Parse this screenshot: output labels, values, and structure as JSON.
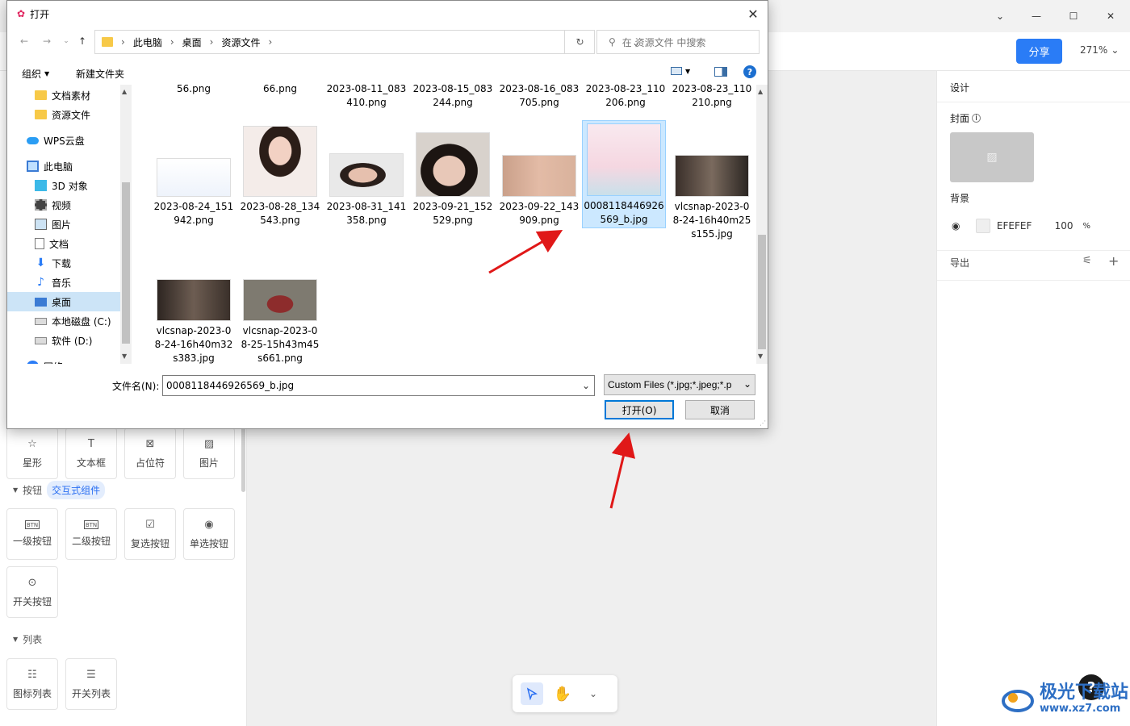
{
  "dialog": {
    "title": "打开",
    "breadcrumb": [
      "此电脑",
      "桌面",
      "资源文件"
    ],
    "search_placeholder": "在 资源文件 中搜索",
    "toolbar": {
      "organize": "组织",
      "new_folder": "新建文件夹"
    },
    "tree": [
      {
        "label": "文档素材",
        "icon": "folder-icon"
      },
      {
        "label": "资源文件",
        "icon": "folder-icon"
      },
      {
        "label": "WPS云盘",
        "icon": "cloud-icon"
      },
      {
        "label": "此电脑",
        "icon": "computer-icon"
      },
      {
        "label": "3D 对象",
        "icon": "cube-icon"
      },
      {
        "label": "视频",
        "icon": "video-icon"
      },
      {
        "label": "图片",
        "icon": "picture-icon"
      },
      {
        "label": "文档",
        "icon": "document-icon"
      },
      {
        "label": "下载",
        "icon": "download-icon"
      },
      {
        "label": "音乐",
        "icon": "music-icon"
      },
      {
        "label": "桌面",
        "icon": "desktop-icon",
        "selected": true
      },
      {
        "label": "本地磁盘 (C:)",
        "icon": "drive-icon"
      },
      {
        "label": "软件 (D:)",
        "icon": "drive-icon"
      },
      {
        "label": "网络",
        "icon": "network-icon"
      }
    ],
    "files_row0": [
      "56.png",
      "66.png",
      "2023-08-11_083410.png",
      "2023-08-15_083244.png",
      "2023-08-16_083705.png",
      "2023-08-23_110206.png",
      "2023-08-23_110210.png"
    ],
    "files_row1": [
      "2023-08-24_151942.png",
      "2023-08-28_134543.png",
      "2023-08-31_141358.png",
      "2023-09-21_152529.png",
      "2023-09-22_143909.png",
      "0008118446926569_b.jpg",
      "vlcsnap-2023-08-24-16h40m25s155.jpg"
    ],
    "files_row2": [
      "vlcsnap-2023-08-24-16h40m32s383.jpg",
      "vlcsnap-2023-08-25-15h43m45s661.png"
    ],
    "filename_label": "文件名(N):",
    "filename_value": "0008118446926569_b.jpg",
    "filetype": "Custom Files (*.jpg;*.jpeg;*.p",
    "open_label": "打开(O)",
    "cancel_label": "取消"
  },
  "app": {
    "share_label": "分享",
    "zoom": "271%",
    "right_panel": {
      "design": "设计",
      "cover": "封面",
      "background": "背景",
      "bg_color": "EFEFEF",
      "opacity": "100",
      "opacity_unit": "%",
      "export": "导出"
    },
    "components_row1": [
      "星形",
      "文本框",
      "占位符",
      "图片"
    ],
    "section_button": "按钮",
    "tag_interactive": "交互式组件",
    "buttons_row1": [
      "一级按钮",
      "二级按钮",
      "复选按钮",
      "单选按钮"
    ],
    "buttons_row2": [
      "开关按钮"
    ],
    "section_list": "列表",
    "lists": [
      "图标列表",
      "开关列表"
    ]
  },
  "watermark": {
    "text": "极光下载站",
    "url": "www.xz7.com"
  }
}
